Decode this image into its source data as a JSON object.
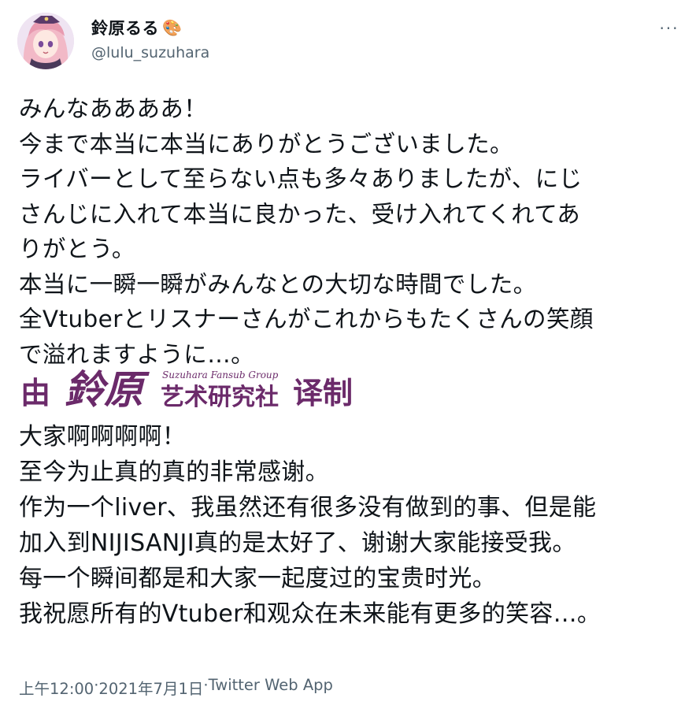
{
  "user": {
    "display_name": "鈴原るる",
    "emoji": "🎨",
    "handle": "@lulu_suzuhara"
  },
  "more_label": "···",
  "tweet_ja": [
    "みんなああああ！",
    "今まで本当に本当にありがとうございました。",
    "ライバーとして至らない点も多々ありましたが、にじ",
    "さんじに入れて本当に良かった、受け入れてくれてあ",
    "りがとう。",
    "本当に一瞬一瞬がみんなとの大切な時間でした。",
    "全Vtuberとリスナーさんがこれからもたくさんの笑顔",
    "で溢れますように…。"
  ],
  "banner": {
    "prefix": "由",
    "name": "鈴原",
    "subtitle": "Suzuhara Fansub Group",
    "group": "艺术研究社",
    "suffix": "译制",
    "color": "#6b2a6a"
  },
  "translation_zh": [
    "大家啊啊啊啊！",
    "至今为止真的真的非常感谢。",
    "作为一个liver、我虽然还有很多没有做到的事、但是能",
    "加入到NIJISANJI真的是太好了、谢谢大家能接受我。",
    "每一个瞬间都是和大家一起度过的宝贵时光。",
    "我祝愿所有的Vtuber和观众在未来能有更多的笑容…。"
  ],
  "meta": {
    "time": "上午12:00",
    "separator": " · ",
    "date": "2021年7月1日",
    "app": "Twitter Web App"
  }
}
